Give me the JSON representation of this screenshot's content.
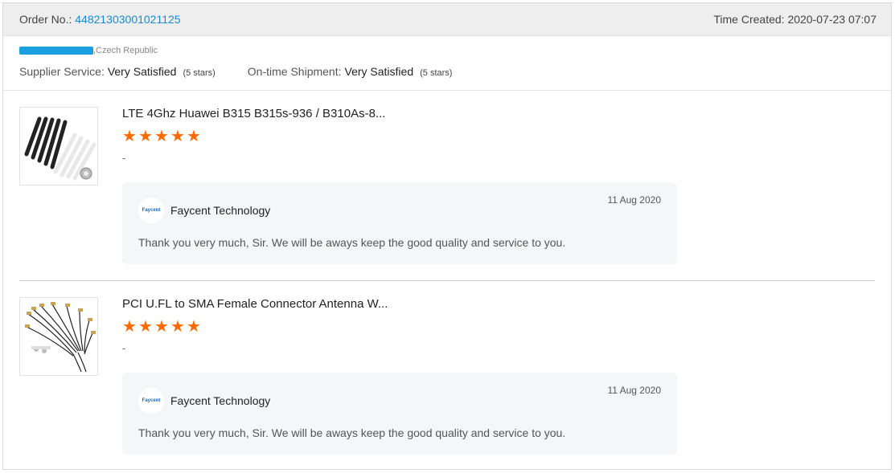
{
  "order": {
    "label": "Order No.: ",
    "number": "44821303001021125",
    "time_label": "Time Created: ",
    "time_value": "2020-07-23 07:07"
  },
  "buyer": {
    "country": ",Czech Republic",
    "supplier_service_label": "Supplier Service:",
    "supplier_service_value": "Very Satisfied",
    "supplier_service_stars": "(5 stars)",
    "shipment_label": "On-time Shipment:",
    "shipment_value": "Very Satisfied",
    "shipment_stars": "(5 stars)"
  },
  "items": [
    {
      "title": "LTE 4Ghz Huawei B315 B315s-936 / B310As-8...",
      "rating": 5,
      "comment": "-",
      "reply": {
        "avatar_text": "Faycent",
        "supplier": "Faycent Technology",
        "date": "11 Aug 2020",
        "text": "Thank you very much, Sir. We will be aways keep the good quality and service to you."
      }
    },
    {
      "title": "PCI U.FL to SMA Female Connector Antenna W...",
      "rating": 5,
      "comment": "-",
      "reply": {
        "avatar_text": "Faycent",
        "supplier": "Faycent Technology",
        "date": "11 Aug 2020",
        "text": "Thank you very much, Sir. We will be aways keep the good quality and service to you."
      }
    }
  ],
  "colors": {
    "accent": "#1a8bd1",
    "star": "#ff6a00",
    "redaction": "#1aa0e0"
  },
  "icons": {
    "star": "star-icon"
  }
}
